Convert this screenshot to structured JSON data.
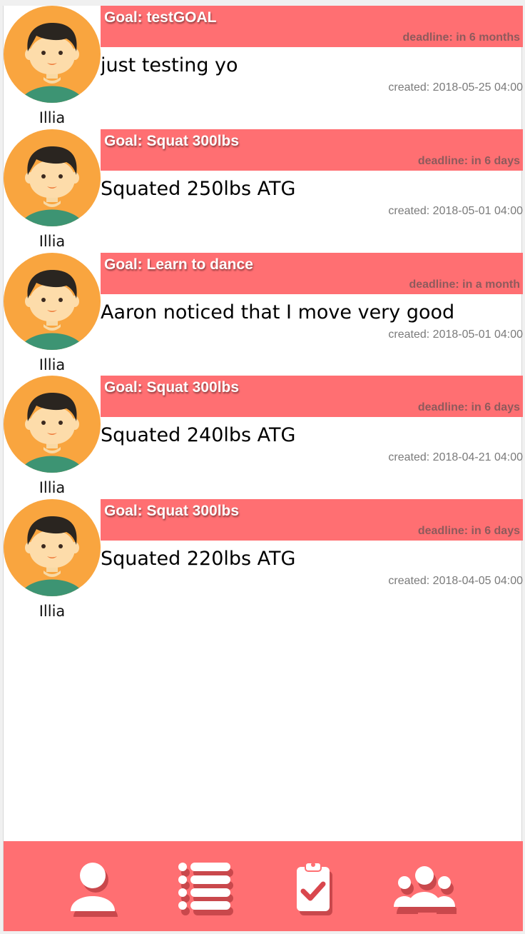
{
  "feed": {
    "posts": [
      {
        "user": "Illia",
        "goal": "Goal: testGOAL",
        "deadline": "deadline: in 6 months",
        "text": "just testing yo",
        "created": "created: 2018-05-25 04:00"
      },
      {
        "user": "Illia",
        "goal": "Goal: Squat 300lbs",
        "deadline": "deadline: in 6 days",
        "text": "Squated 250lbs ATG",
        "created": "created: 2018-05-01 04:00"
      },
      {
        "user": "Illia",
        "goal": "Goal: Learn to dance",
        "deadline": "deadline: in a month",
        "text": "Aaron noticed that I move very good",
        "created": "created: 2018-05-01 04:00"
      },
      {
        "user": "Illia",
        "goal": "Goal: Squat 300lbs",
        "deadline": "deadline: in 6 days",
        "text": "Squated 240lbs ATG",
        "created": "created: 2018-04-21 04:00"
      },
      {
        "user": "Illia",
        "goal": "Goal: Squat 300lbs",
        "deadline": "deadline: in 6 days",
        "text": "Squated 220lbs ATG",
        "created": "created: 2018-04-05 04:00"
      }
    ]
  },
  "nav": {
    "items": [
      {
        "icon": "profile-icon"
      },
      {
        "icon": "list-icon"
      },
      {
        "icon": "clipboard-check-icon"
      },
      {
        "icon": "group-icon"
      }
    ]
  },
  "colors": {
    "accent": "#ff6f72",
    "deadline_text": "#8e5a5c",
    "avatar_bg": "#f9a53f",
    "avatar_shirt": "#3d9473"
  }
}
